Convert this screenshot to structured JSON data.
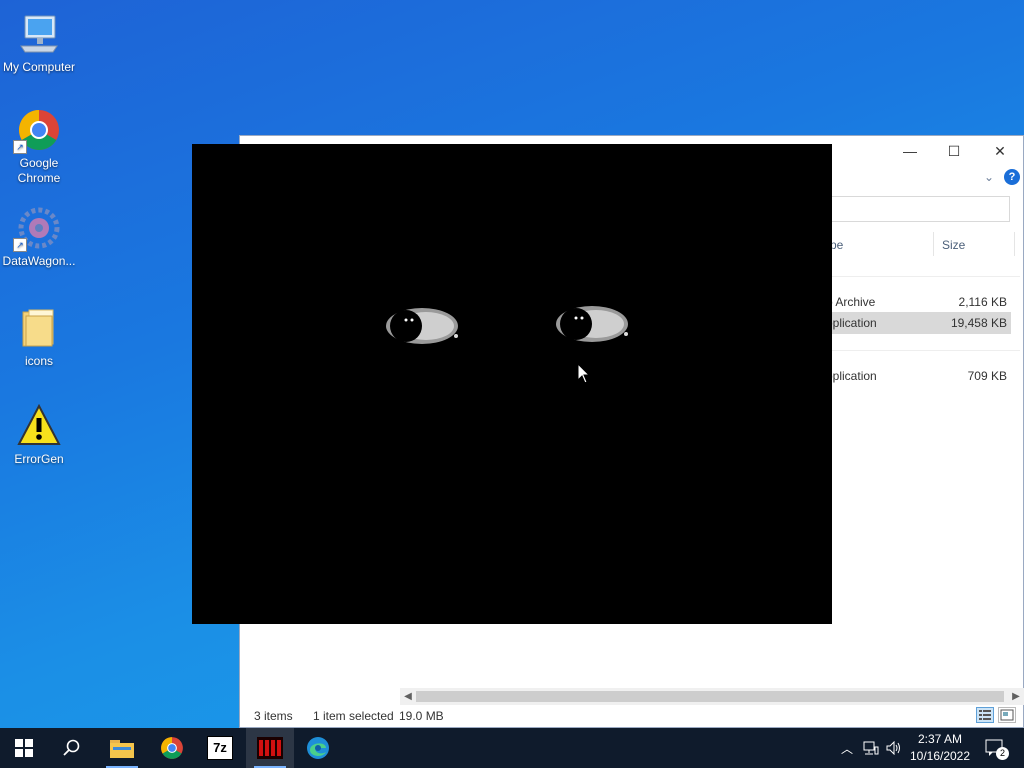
{
  "desktop": {
    "icons": [
      {
        "label": "My Computer"
      },
      {
        "label": "Google Chrome"
      },
      {
        "label": "DataWagon..."
      },
      {
        "label": "icons"
      },
      {
        "label": "ErrorGen"
      }
    ]
  },
  "explorer": {
    "columns": {
      "type": "pe",
      "size": "Size"
    },
    "files": [
      {
        "type": "p Archive",
        "size": "2,116 KB",
        "selected": false
      },
      {
        "type": "pplication",
        "size": "19,458 KB",
        "selected": true
      },
      {
        "type": "pplication",
        "size": "709 KB",
        "selected": false
      }
    ],
    "status": {
      "items": "3 items",
      "selection": "1 item selected",
      "selection_size": "19.0 MB"
    },
    "window_buttons": {
      "minimize": "—",
      "maximize": "☐",
      "close": "✕"
    },
    "help_glyph": "?"
  },
  "taskbar": {
    "apps": [
      {
        "name": "start-icon"
      },
      {
        "name": "search-icon"
      },
      {
        "name": "file-explorer-icon"
      },
      {
        "name": "chrome-icon"
      },
      {
        "name": "7zip-icon",
        "label": "7z"
      },
      {
        "name": "app-icon",
        "active": true
      },
      {
        "name": "edge-icon"
      }
    ],
    "clock": {
      "time": "2:37 AM",
      "date": "10/16/2022"
    },
    "notifications_count": "2"
  },
  "colors": {
    "taskbar_bg": "#0f1b2c",
    "selection_bg": "#d9d9d9",
    "accent": "#1a6ed8"
  }
}
